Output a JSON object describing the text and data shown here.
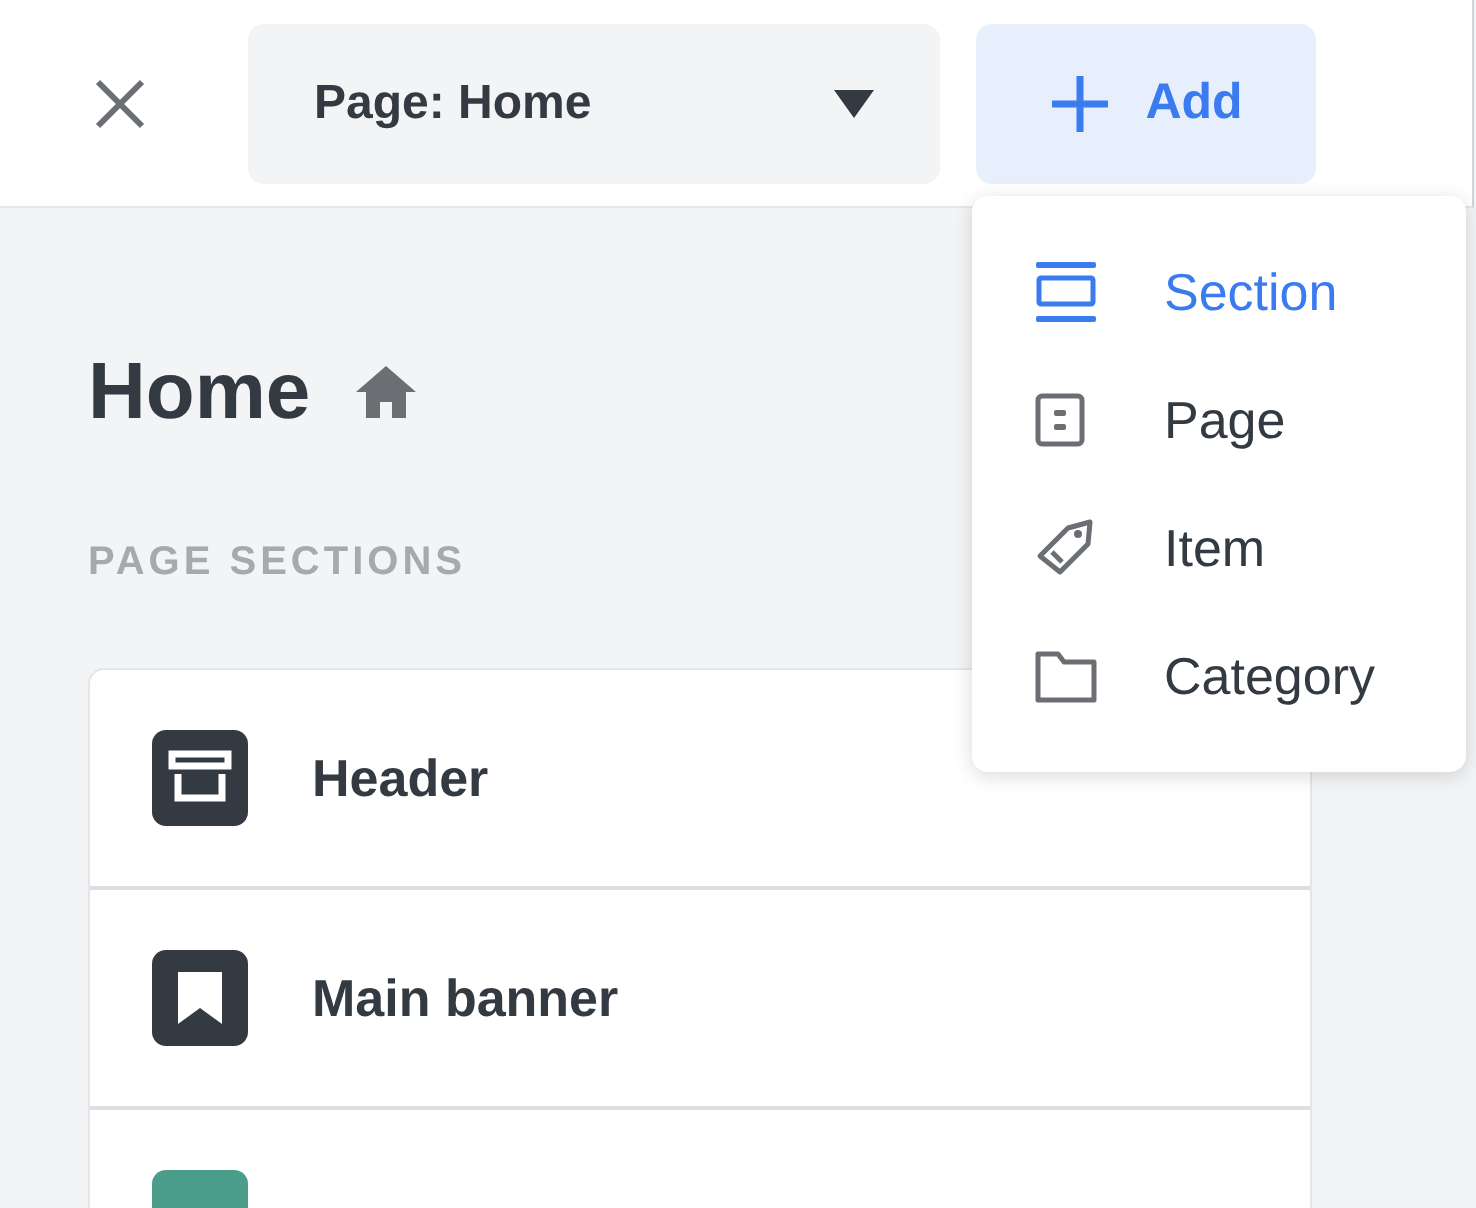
{
  "toolbar": {
    "page_select": {
      "value": "Page: Home"
    },
    "add_button": {
      "label": "Add"
    }
  },
  "add_menu": [
    {
      "label": "Section",
      "kind": "section",
      "selected": true
    },
    {
      "label": "Page",
      "kind": "page",
      "selected": false
    },
    {
      "label": "Item",
      "kind": "item",
      "selected": false
    },
    {
      "label": "Category",
      "kind": "category",
      "selected": false
    }
  ],
  "page": {
    "title": "Home",
    "sections_heading": "PAGE SECTIONS"
  },
  "sections": [
    {
      "name": "Header",
      "kind": "header",
      "color": "#333a41"
    },
    {
      "name": "Main banner",
      "kind": "banner",
      "color": "#333a41"
    },
    {
      "kind": "blank",
      "color": "#4a9d8a"
    }
  ]
}
